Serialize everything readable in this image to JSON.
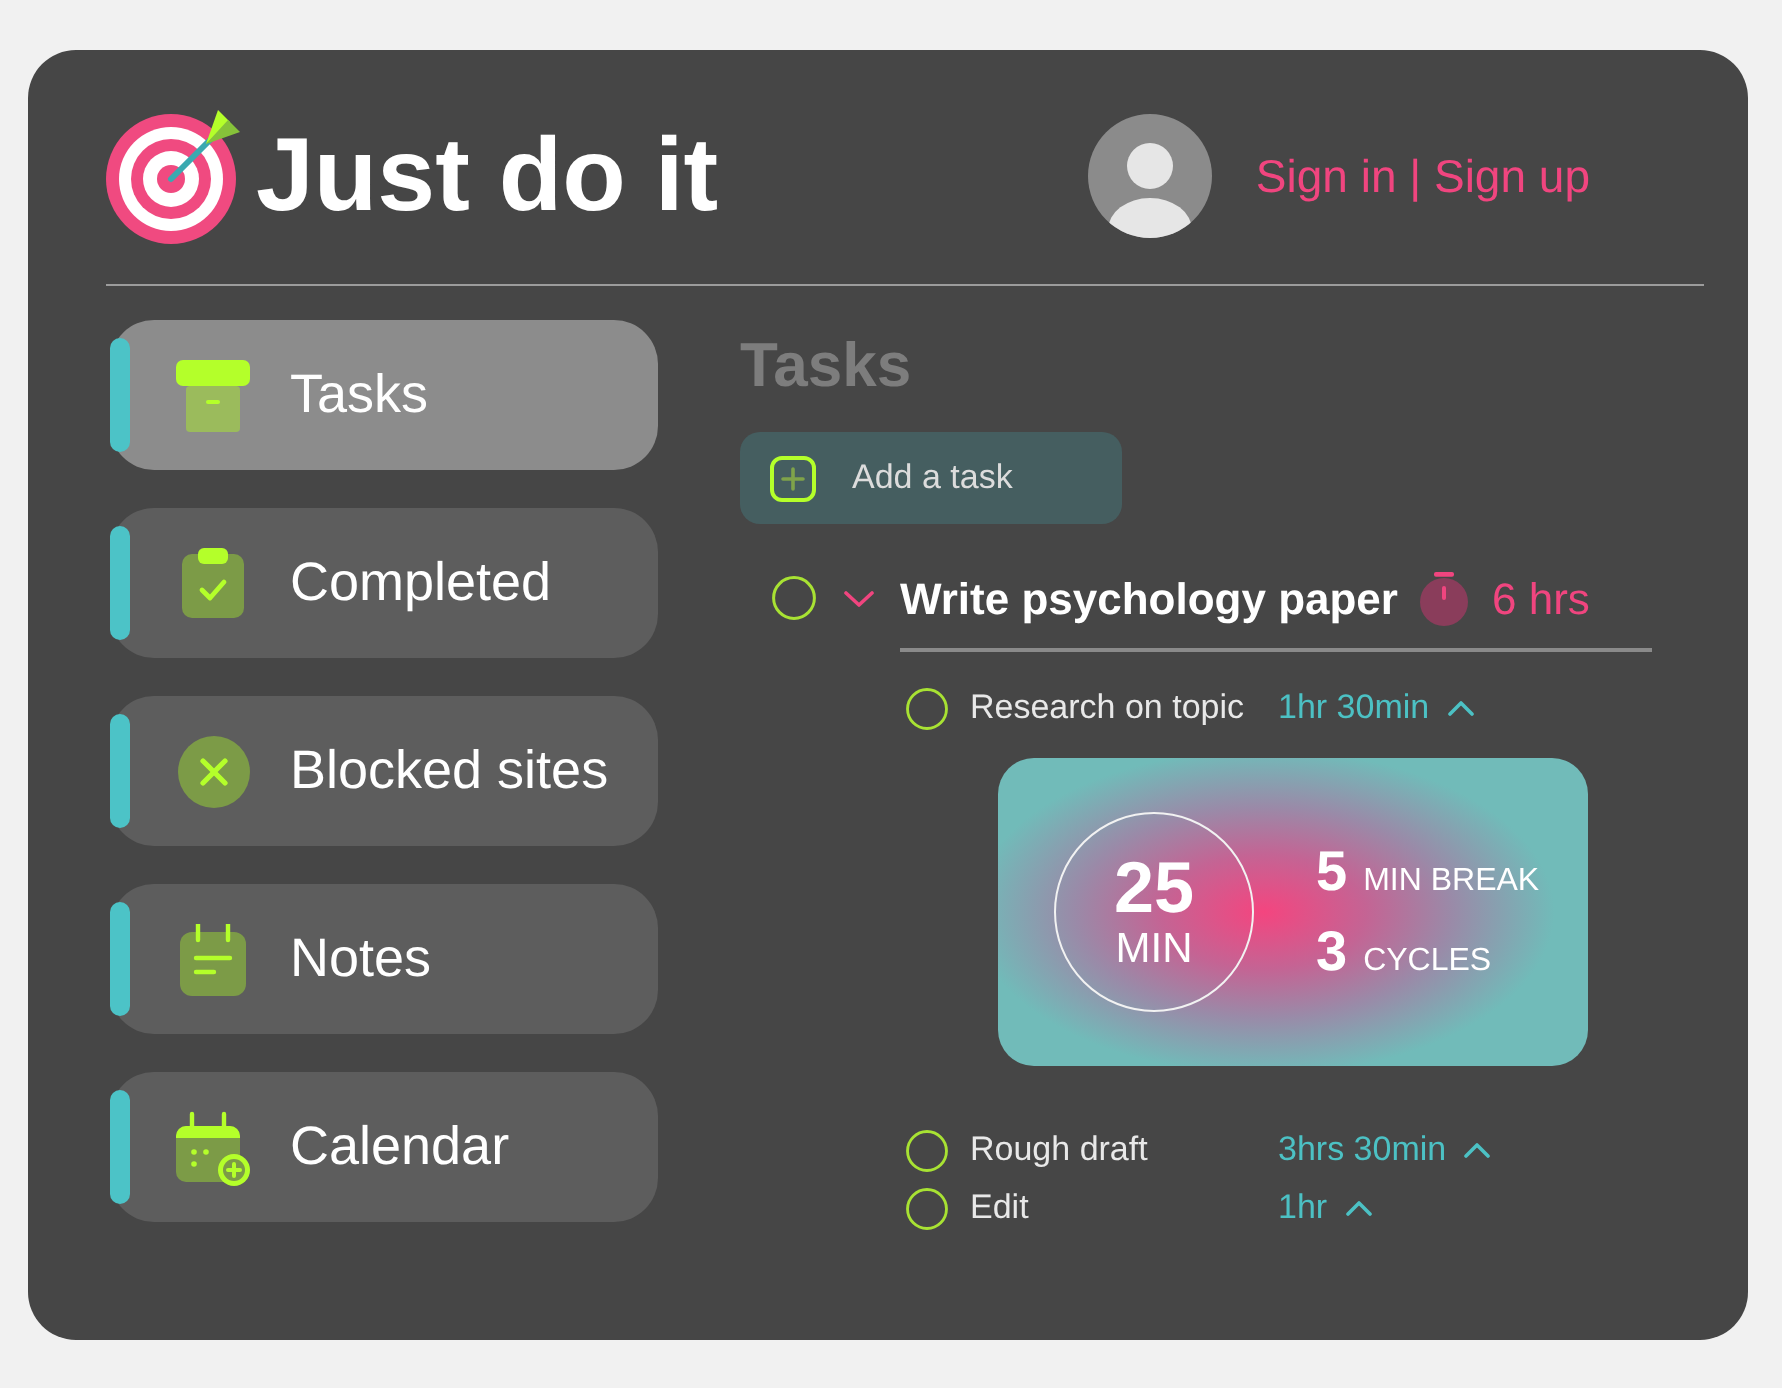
{
  "header": {
    "title": "Just do it",
    "auth_link": "Sign in | Sign up"
  },
  "sidebar": {
    "items": [
      {
        "label": "Tasks",
        "kind": "archive",
        "selected": true
      },
      {
        "label": "Completed",
        "kind": "clipboard",
        "selected": false
      },
      {
        "label": "Blocked sites",
        "kind": "blocked",
        "selected": false
      },
      {
        "label": "Notes",
        "kind": "notes",
        "selected": false
      },
      {
        "label": "Calendar",
        "kind": "calendar",
        "selected": false
      }
    ]
  },
  "main": {
    "heading": "Tasks",
    "add_button": "Add a task",
    "tasks": [
      {
        "title": "Write psychology paper",
        "done": false,
        "duration": "6 hrs",
        "subtasks": [
          {
            "title": "Research on topic",
            "done": false,
            "duration": "1hr 30min",
            "timer": {
              "focus": "25",
              "focus_unit": "MIN",
              "break": "5",
              "break_label": "MIN BREAK",
              "cycles": "3",
              "cycles_label": "CYCLES"
            }
          },
          {
            "title": "Rough draft",
            "done": false,
            "duration": "3hrs 30min"
          },
          {
            "title": "Edit",
            "done": false,
            "duration": "1hr"
          }
        ]
      }
    ]
  }
}
